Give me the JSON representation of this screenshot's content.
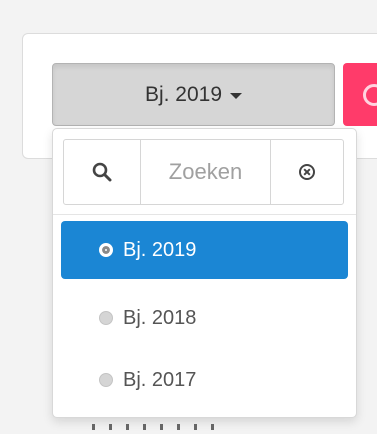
{
  "dropdown": {
    "selected_label": "Bj. 2019"
  },
  "search": {
    "placeholder": "Zoeken"
  },
  "options": [
    {
      "label": "Bj. 2019",
      "selected": true
    },
    {
      "label": "Bj. 2018",
      "selected": false
    },
    {
      "label": "Bj. 2017",
      "selected": false
    }
  ],
  "colors": {
    "active_option": "#1b86d4",
    "toggle_background": "#d6d6d6",
    "pink_button": "#ff3b6a"
  },
  "icons": {
    "search": "search-icon",
    "clear": "clear-search-icon",
    "caret": "caret-down-icon",
    "pink_button": "circle-icon"
  }
}
